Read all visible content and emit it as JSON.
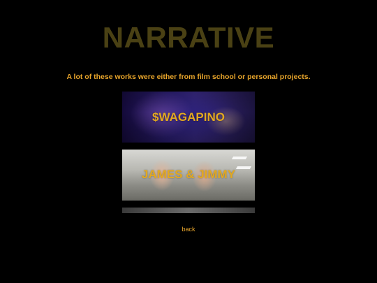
{
  "header": {
    "title": "NARRATIVE"
  },
  "intro": {
    "text": "A lot of these works were either from film school or personal projects."
  },
  "projects": [
    {
      "label": "$WAGAPINO"
    },
    {
      "label": "JAMES & JIMMY"
    },
    {
      "label": ""
    }
  ],
  "nav": {
    "back_label": "back"
  },
  "colors": {
    "background": "#000000",
    "accent": "#e8a52b",
    "title": "#4a4114"
  }
}
